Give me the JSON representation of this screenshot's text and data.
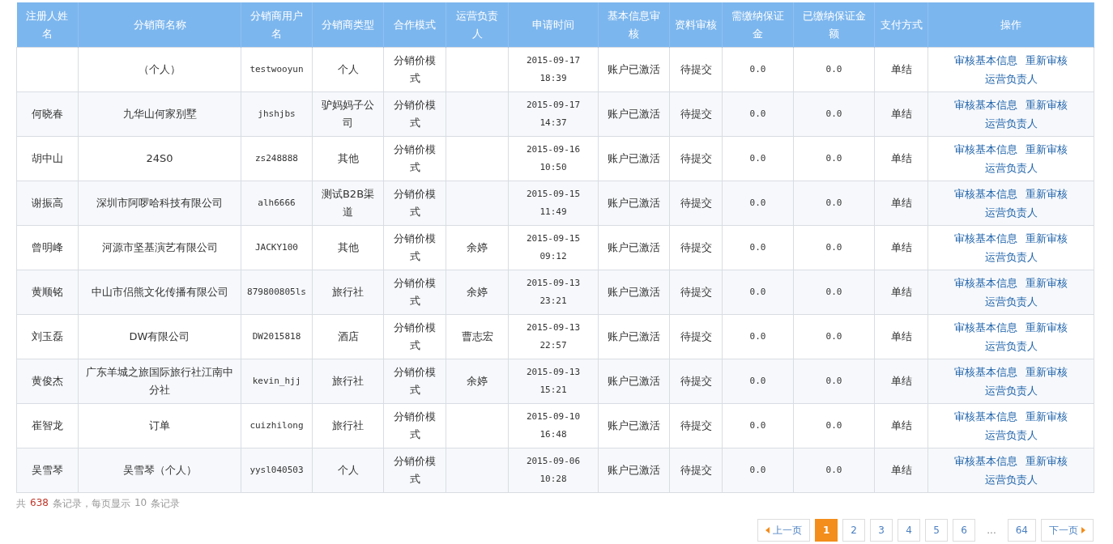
{
  "table": {
    "columns": [
      "注册人姓名",
      "分销商名称",
      "分销商用户名",
      "分销商类型",
      "合作模式",
      "运营负责人",
      "申请时间",
      "基本信息审核",
      "资料审核",
      "需缴纳保证金",
      "已缴纳保证金额",
      "支付方式",
      "操作"
    ],
    "rows": [
      {
        "cells": [
          "",
          "（个人）",
          "testwooyun",
          "个人",
          "分销价模式",
          "",
          "2015-09-17 18:39",
          "账户已激活",
          "待提交",
          "0.0",
          "0.0",
          "单结"
        ],
        "actions": [
          "审核基本信息",
          "重新审核",
          "运营负责人"
        ]
      },
      {
        "cells": [
          "何晓春",
          "九华山何家别墅",
          "jhshjbs",
          "驴妈妈子公司",
          "分销价模式",
          "",
          "2015-09-17 14:37",
          "账户已激活",
          "待提交",
          "0.0",
          "0.0",
          "单结"
        ],
        "actions": [
          "审核基本信息",
          "重新审核",
          "运营负责人"
        ]
      },
      {
        "cells": [
          "胡中山",
          "24S0",
          "zs248888",
          "其他",
          "分销价模式",
          "",
          "2015-09-16 10:50",
          "账户已激活",
          "待提交",
          "0.0",
          "0.0",
          "单结"
        ],
        "actions": [
          "审核基本信息",
          "重新审核",
          "运营负责人"
        ]
      },
      {
        "cells": [
          "谢振高",
          "深圳市阿啰哈科技有限公司",
          "alh6666",
          "测试B2B渠道",
          "分销价模式",
          "",
          "2015-09-15 11:49",
          "账户已激活",
          "待提交",
          "0.0",
          "0.0",
          "单结"
        ],
        "actions": [
          "审核基本信息",
          "重新审核",
          "运营负责人"
        ]
      },
      {
        "cells": [
          "曾明峰",
          "河源市坚基演艺有限公司",
          "JACKY100",
          "其他",
          "分销价模式",
          "余婷",
          "2015-09-15 09:12",
          "账户已激活",
          "待提交",
          "0.0",
          "0.0",
          "单结"
        ],
        "actions": [
          "审核基本信息",
          "重新审核",
          "运营负责人"
        ]
      },
      {
        "cells": [
          "黄顺铭",
          "中山市侣熊文化传播有限公司",
          "879800805ls",
          "旅行社",
          "分销价模式",
          "余婷",
          "2015-09-13 23:21",
          "账户已激活",
          "待提交",
          "0.0",
          "0.0",
          "单结"
        ],
        "actions": [
          "审核基本信息",
          "重新审核",
          "运营负责人"
        ]
      },
      {
        "cells": [
          "刘玉磊",
          "DW有限公司",
          "DW2015818",
          "酒店",
          "分销价模式",
          "曹志宏",
          "2015-09-13 22:57",
          "账户已激活",
          "待提交",
          "0.0",
          "0.0",
          "单结"
        ],
        "actions": [
          "审核基本信息",
          "重新审核",
          "运营负责人"
        ]
      },
      {
        "cells": [
          "黄俊杰",
          "广东羊城之旅国际旅行社江南中分社",
          "kevin_hjj",
          "旅行社",
          "分销价模式",
          "余婷",
          "2015-09-13 15:21",
          "账户已激活",
          "待提交",
          "0.0",
          "0.0",
          "单结"
        ],
        "actions": [
          "审核基本信息",
          "重新审核",
          "运营负责人"
        ]
      },
      {
        "cells": [
          "崔智龙",
          "订单",
          "cuizhilong",
          "旅行社",
          "分销价模式",
          "",
          "2015-09-10 16:48",
          "账户已激活",
          "待提交",
          "0.0",
          "0.0",
          "单结"
        ],
        "actions": [
          "审核基本信息",
          "重新审核",
          "运营负责人"
        ]
      },
      {
        "cells": [
          "吴雪琴",
          "吴雪琴（个人）",
          "yysl040503",
          "个人",
          "分销价模式",
          "",
          "2015-09-06 10:28",
          "账户已激活",
          "待提交",
          "0.0",
          "0.0",
          "单结"
        ],
        "actions": [
          "审核基本信息",
          "重新审核",
          "运营负责人"
        ]
      }
    ]
  },
  "summary": {
    "prefix": "共",
    "total": "638",
    "middle": "条记录，每页显示",
    "per_page": "10",
    "suffix": "条记录"
  },
  "pagination": {
    "prev": "上一页",
    "next": "下一页",
    "pages": [
      {
        "kind": "page",
        "label": "1",
        "selected": true
      },
      {
        "kind": "page",
        "label": "2",
        "selected": false
      },
      {
        "kind": "page",
        "label": "3",
        "selected": false
      },
      {
        "kind": "page",
        "label": "4",
        "selected": false
      },
      {
        "kind": "page",
        "label": "5",
        "selected": false
      },
      {
        "kind": "page",
        "label": "6",
        "selected": false
      },
      {
        "kind": "gap",
        "label": "..."
      },
      {
        "kind": "page",
        "label": "64",
        "selected": false
      }
    ]
  }
}
